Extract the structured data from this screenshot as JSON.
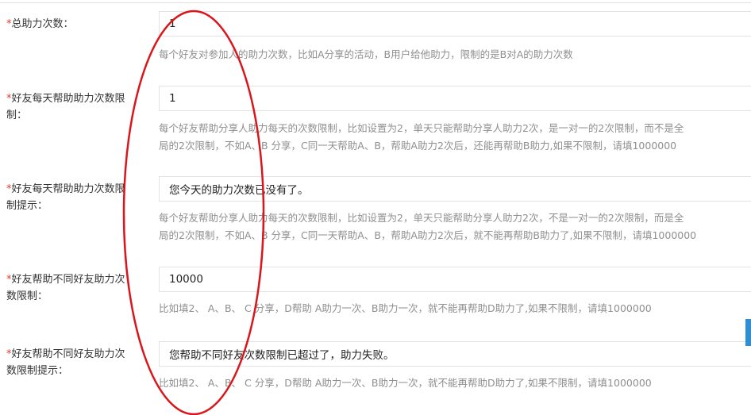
{
  "form": {
    "required_mark": "*",
    "rows": [
      {
        "label": "总助力次数：",
        "value": "1",
        "help": "每个好友对参加人的助力次数，比如A分享的活动，B用户给他助力，限制的是B对A的助力次数"
      },
      {
        "label_line1": "好友每天帮助助力次数限",
        "label_line2": "制：",
        "value": "1",
        "help_line1": "每个好友帮助分享人助力每天的次数限制，比如设置为2，单天只能帮助分享人助力2次，是一对一的2次限制，而不是全",
        "help_line2": "局的2次限制，不如A、B 分享，C同一天帮助A、B，帮助A助力2次后，还能再帮助B助力,如果不限制，请填1000000"
      },
      {
        "label_line1": "好友每天帮助助力次数限",
        "label_line2": "制提示：",
        "value": "您今天的助力次数已没有了。",
        "help_line1": "每个好友帮助分享人助力每天的次数限制，比如设置为2，单天只能帮助分享人助力2次，不是一对一的2次限制，而是全",
        "help_line2": "局的2次限制，不如A、B 分享，C同一天帮助A、B，帮助A助力2次后，就不能再帮助B助力了,如果不限制，请填1000000"
      },
      {
        "label_line1": "好友帮助不同好友助力次",
        "label_line2": "数限制：",
        "value": "10000",
        "help": "比如填2、 A、B、 C 分享，D帮助 A助力一次、B助力一次，就不能再帮助D助力了,如果不限制，请填1000000"
      },
      {
        "label_line1": "好友帮助不同好友助力次",
        "label_line2": "数限制提示：",
        "value": "您帮助不同好友次数限制已超过了，助力失败。",
        "help": "比如填2、 A、B、 C 分享，D帮助 A助力一次、B助力一次，就不能再帮助D助力了,如果不限制，请填1000000"
      }
    ]
  },
  "colors": {
    "required": "#e23b2c",
    "annotation": "#d9161c",
    "scrollbar": "#2f8fd4"
  }
}
